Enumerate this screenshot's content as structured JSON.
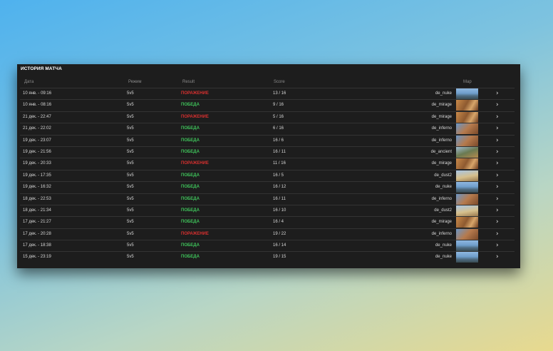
{
  "panel": {
    "title": "ИСТОРИЯ МАТЧА"
  },
  "columns": {
    "date": "Дата",
    "mode": "Режим",
    "result": "Result",
    "score": "Score",
    "map": "Map"
  },
  "chevron": "›",
  "matches": [
    {
      "date": "10 янв. - 09:16",
      "mode": "5v5",
      "result": "ПОРАЖЕНИЕ",
      "outcome": "loss",
      "score": "13 / 16",
      "map": "de_nuke",
      "thumb": "nuke"
    },
    {
      "date": "10 янв. - 08:16",
      "mode": "5v5",
      "result": "ПОБЕДА",
      "outcome": "win",
      "score": "9 / 16",
      "map": "de_mirage",
      "thumb": "mirage"
    },
    {
      "date": "21 дек. - 22:47",
      "mode": "5v5",
      "result": "ПОРАЖЕНИЕ",
      "outcome": "loss",
      "score": "5 / 16",
      "map": "de_mirage",
      "thumb": "mirage"
    },
    {
      "date": "21 дек. - 22:02",
      "mode": "5v5",
      "result": "ПОБЕДА",
      "outcome": "win",
      "score": "6 / 16",
      "map": "de_inferno",
      "thumb": "inferno"
    },
    {
      "date": "19 дек. - 23:07",
      "mode": "5v5",
      "result": "ПОБЕДА",
      "outcome": "win",
      "score": "16 / 6",
      "map": "de_inferno",
      "thumb": "inferno"
    },
    {
      "date": "19 дек. - 21:56",
      "mode": "5v5",
      "result": "ПОБЕДА",
      "outcome": "win",
      "score": "16 / 11",
      "map": "de_ancient",
      "thumb": "ancient"
    },
    {
      "date": "19 дек. - 20:33",
      "mode": "5v5",
      "result": "ПОРАЖЕНИЕ",
      "outcome": "loss",
      "score": "11 / 16",
      "map": "de_mirage",
      "thumb": "mirage"
    },
    {
      "date": "19 дек. - 17:35",
      "mode": "5v5",
      "result": "ПОБЕДА",
      "outcome": "win",
      "score": "16 / 5",
      "map": "de_dust2",
      "thumb": "dust2"
    },
    {
      "date": "19 дек. - 16:32",
      "mode": "5v5",
      "result": "ПОБЕДА",
      "outcome": "win",
      "score": "16 / 12",
      "map": "de_nuke",
      "thumb": "nuke"
    },
    {
      "date": "18 дек. - 22:53",
      "mode": "5v5",
      "result": "ПОБЕДА",
      "outcome": "win",
      "score": "16 / 11",
      "map": "de_inferno",
      "thumb": "inferno"
    },
    {
      "date": "18 дек. - 21:34",
      "mode": "5v5",
      "result": "ПОБЕДА",
      "outcome": "win",
      "score": "16 / 10",
      "map": "de_dust2",
      "thumb": "dust2"
    },
    {
      "date": "17 дек. - 21:27",
      "mode": "5v5",
      "result": "ПОБЕДА",
      "outcome": "win",
      "score": "16 / 4",
      "map": "de_mirage",
      "thumb": "mirage"
    },
    {
      "date": "17 дек. - 20:28",
      "mode": "5v5",
      "result": "ПОРАЖЕНИЕ",
      "outcome": "loss",
      "score": "19 / 22",
      "map": "de_inferno",
      "thumb": "inferno"
    },
    {
      "date": "17 дек. - 18:38",
      "mode": "5v5",
      "result": "ПОБЕДА",
      "outcome": "win",
      "score": "16 / 14",
      "map": "de_nuke",
      "thumb": "nuke"
    },
    {
      "date": "15 дек. - 23:19",
      "mode": "5v5",
      "result": "ПОБЕДА",
      "outcome": "win",
      "score": "19 / 15",
      "map": "de_nuke",
      "thumb": "nuke"
    }
  ]
}
